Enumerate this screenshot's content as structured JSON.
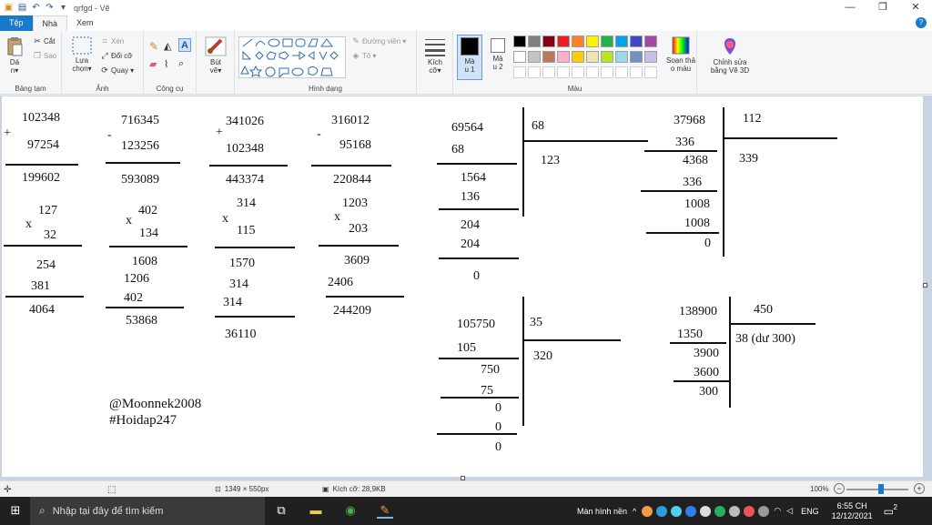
{
  "window": {
    "title": "qrfgd - Vẽ",
    "controls": [
      "—",
      "❐",
      "✕"
    ]
  },
  "tabs": [
    {
      "label": "Tệp"
    },
    {
      "label": "Nhà"
    },
    {
      "label": "Xem"
    }
  ],
  "ribbon": {
    "clipboard": {
      "paste": "Dá",
      "paste2": "n",
      "cut": "Cắt",
      "copy": "Sao",
      "label": "Bảng tạm"
    },
    "image": {
      "select": "Lựa",
      "select2": "chọn",
      "crop": "Xén",
      "resize": "Đổi cỡ",
      "rotate": "Quay",
      "label": "Ảnh"
    },
    "tools": {
      "label": "Công cụ"
    },
    "brushes": {
      "label": "Bút",
      "label2": "vẽ"
    },
    "shapes": {
      "outline": "Đường viền",
      "fill": "Tô",
      "label": "Hình dạng"
    },
    "size": {
      "label": "Kích",
      "label2": "cỡ"
    },
    "color1": {
      "label": "Mà",
      "label2": "u 1"
    },
    "color2": {
      "label": "Mà",
      "label2": "u 2"
    },
    "colors": {
      "label": "Màu",
      "palette_row1": [
        "#000000",
        "#7f7f7f",
        "#880015",
        "#ed1c24",
        "#ff7f27",
        "#fff200",
        "#22b14c",
        "#00a2e8",
        "#3f48cc",
        "#a349a4"
      ],
      "palette_row2": [
        "#ffffff",
        "#c3c3c3",
        "#b97a57",
        "#ffaec9",
        "#ffc90e",
        "#efe4b0",
        "#b5e61d",
        "#99d9ea",
        "#7092be",
        "#c8bfe7"
      ]
    },
    "edit_colors": {
      "label": "Soạn thả",
      "label2": "o màu"
    },
    "paint3d": {
      "label": "Chỉnh sửa",
      "label2": "bằng Vẽ 3D"
    }
  },
  "canvas_text": {
    "add1": {
      "a": "102348",
      "op": "+",
      "b": "97254",
      "r": "199602"
    },
    "sub1": {
      "a": "716345",
      "op": "-",
      "b": "123256",
      "r": "593089"
    },
    "add2": {
      "a": "341026",
      "op": "+",
      "b": "102348",
      "r": "443374"
    },
    "sub2": {
      "a": "316012",
      "op": "-",
      "b": "95168",
      "r": "220844"
    },
    "mul1": {
      "a": "127",
      "op": "x",
      "b": "32",
      "p1": "254",
      "p2": "381",
      "r": "4064"
    },
    "mul2": {
      "a": "402",
      "op": "x",
      "b": "134",
      "p1": "1608",
      "p2": "1206",
      "p3": "402",
      "r": "53868"
    },
    "mul3": {
      "a": "314",
      "op": "x",
      "b": "115",
      "p1": "1570",
      "p2": "314",
      "p3": "314",
      "r": "36110"
    },
    "mul4": {
      "a": "1203",
      "op": "x",
      "b": "203",
      "p1": "3609",
      "p2": "2406",
      "r": "244209"
    },
    "div1": {
      "dividend": "69564",
      "divisor": "68",
      "quotient": "123",
      "s1": "68",
      "s2": "1564",
      "s3": "136",
      "s4": "204",
      "s5": "204",
      "s6": "0"
    },
    "div2": {
      "dividend": "37968",
      "divisor": "112",
      "quotient": "339",
      "s1": "336",
      "s2": "4368",
      "s3": "336",
      "s4": "1008",
      "s5": "1008",
      "s6": "0"
    },
    "div3": {
      "dividend": "105750",
      "divisor": "35",
      "quotient": "320",
      "s1": "105",
      "s2": "750",
      "s3": "75",
      "s4": "0",
      "s5": "0",
      "s6": "0"
    },
    "div4": {
      "dividend": "138900",
      "divisor": "450",
      "quotient": "38 (dư 300)",
      "s1": "1350",
      "s2": "3900",
      "s3": "3600",
      "s4": "300"
    },
    "sig1": "@Moonnek2008",
    "sig2": "#Hoidap247"
  },
  "status": {
    "dimensions": "1349 × 550px",
    "filesize": "Kích cỡ: 28,9KB",
    "zoom": "100%"
  },
  "taskbar": {
    "search_placeholder": "Nhập tại đây để tìm kiếm",
    "desktop": "Màn hình nền",
    "lang": "ENG",
    "time": "6:55 CH",
    "date": "12/12/2021",
    "notif": "2"
  }
}
